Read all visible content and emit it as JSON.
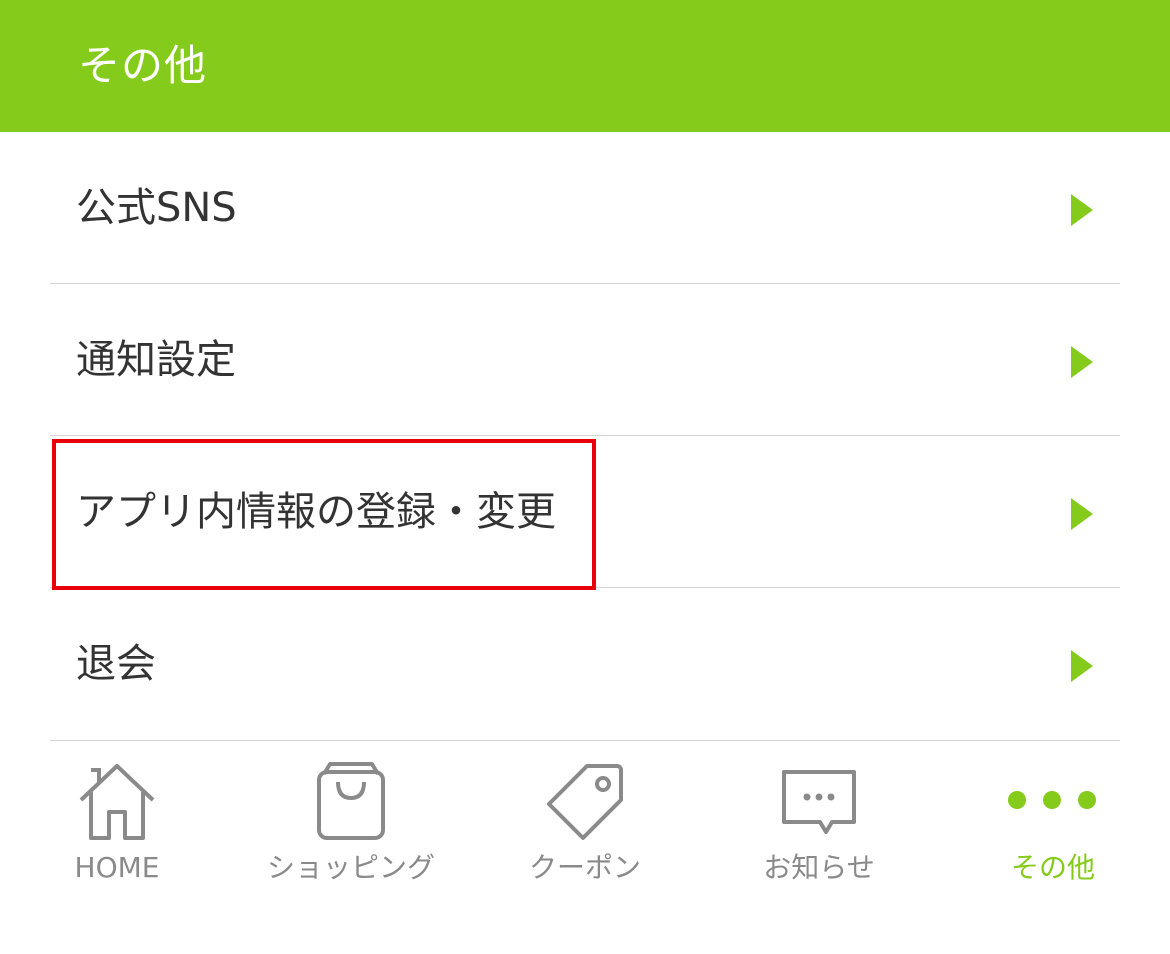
{
  "header": {
    "title": "その他"
  },
  "menu": {
    "items": [
      {
        "label": "公式SNS"
      },
      {
        "label": "通知設定"
      },
      {
        "label": "アプリ内情報の登録・変更"
      },
      {
        "label": "退会"
      }
    ]
  },
  "tabbar": {
    "tabs": [
      {
        "label": "HOME",
        "icon": "home-icon"
      },
      {
        "label": "ショッピング",
        "icon": "shopping-bag-icon"
      },
      {
        "label": "クーポン",
        "icon": "tag-icon"
      },
      {
        "label": "お知らせ",
        "icon": "speech-bubble-icon"
      },
      {
        "label": "その他",
        "icon": "more-dots-icon",
        "active": true
      }
    ]
  },
  "colors": {
    "accent": "#85cb1c",
    "highlight": "#e8000b",
    "text": "#333333",
    "inactive": "#8a8a8a"
  }
}
